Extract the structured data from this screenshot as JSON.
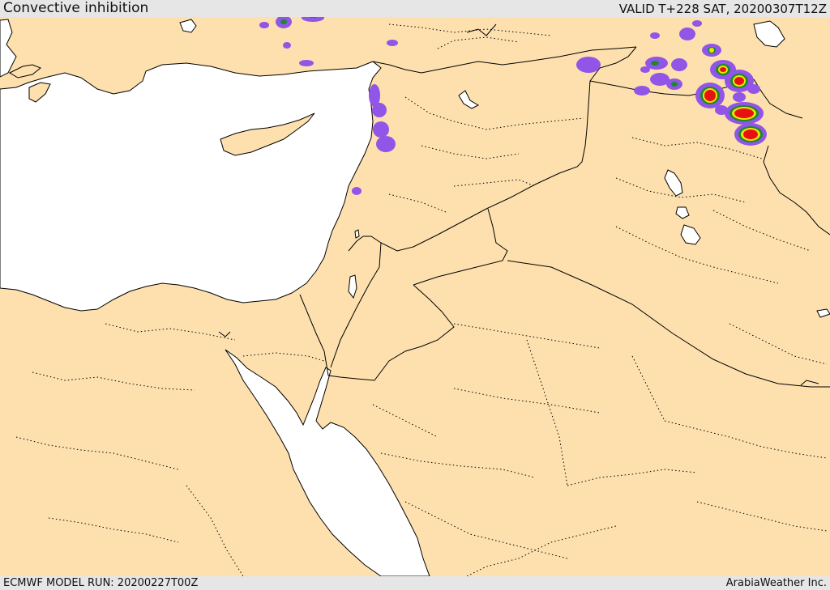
{
  "header": {
    "title": "Convective inhibition",
    "valid": "VALID T+228 SAT, 20200307T12Z"
  },
  "footer": {
    "model_run": "ECMWF MODEL RUN: 20200227T00Z",
    "credit": "ArabiaWeather Inc."
  },
  "colors": {
    "land": "#fde0ae",
    "sea": "#ffffff",
    "cin_light": "#9155e8",
    "cin_mid": "#1a8a2a",
    "cin_high1": "#f2e400",
    "cin_high2": "#e81010",
    "border": "#000000"
  }
}
